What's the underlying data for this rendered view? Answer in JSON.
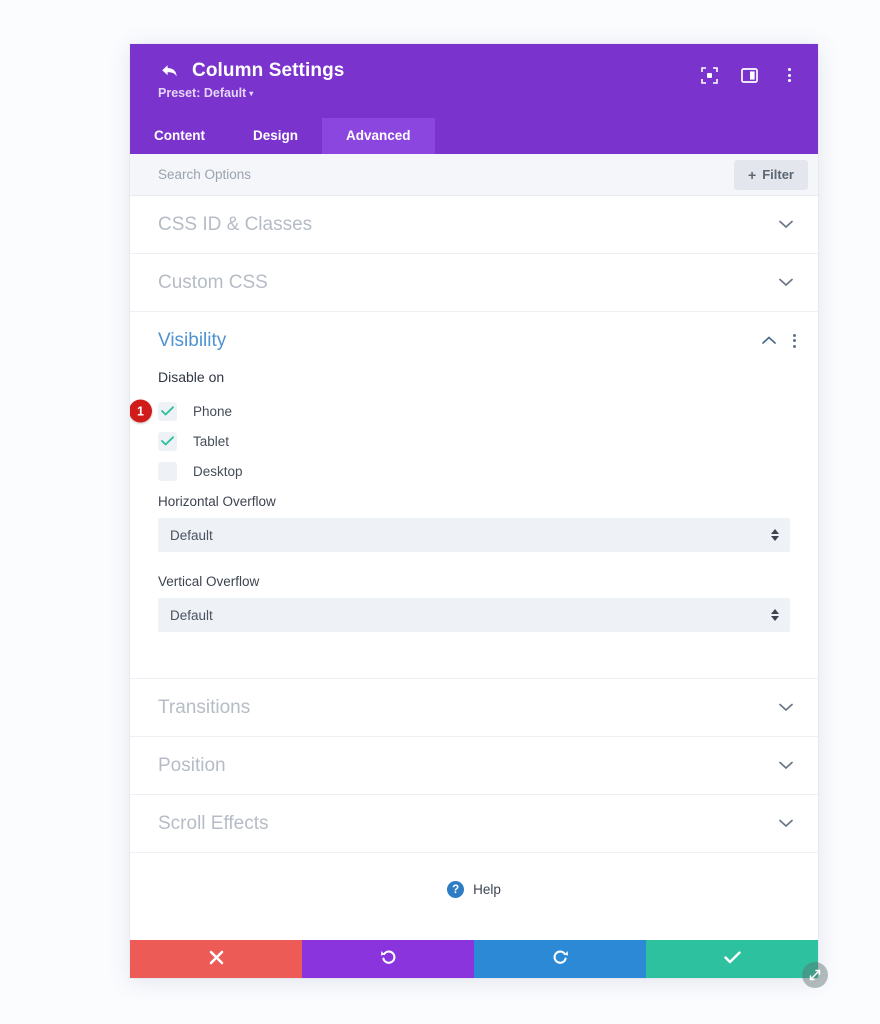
{
  "header": {
    "title": "Column Settings",
    "preset_label": "Preset: Default",
    "preset_caret": "▾",
    "back_icon": "back-arrow-icon",
    "icons": [
      {
        "name": "focus-frame-icon"
      },
      {
        "name": "split-layout-icon"
      },
      {
        "name": "more-options-icon"
      }
    ]
  },
  "tabs": [
    {
      "label": "Content",
      "active": false
    },
    {
      "label": "Design",
      "active": false
    },
    {
      "label": "Advanced",
      "active": true
    }
  ],
  "search": {
    "placeholder": "Search Options",
    "value": "",
    "filter_label": "Filter",
    "filter_plus": "+"
  },
  "sections": [
    {
      "title": "CSS ID & Classes",
      "open": false
    },
    {
      "title": "Custom CSS",
      "open": false
    },
    {
      "title": "Visibility",
      "open": true
    },
    {
      "title": "Transitions",
      "open": false
    },
    {
      "title": "Position",
      "open": false
    },
    {
      "title": "Scroll Effects",
      "open": false
    }
  ],
  "visibility": {
    "disable_on_label": "Disable on",
    "checkboxes": [
      {
        "label": "Phone",
        "checked": true,
        "badge": "1"
      },
      {
        "label": "Tablet",
        "checked": true,
        "badge": null
      },
      {
        "label": "Desktop",
        "checked": false,
        "badge": null
      }
    ],
    "horizontal_overflow": {
      "label": "Horizontal Overflow",
      "value": "Default"
    },
    "vertical_overflow": {
      "label": "Vertical Overflow",
      "value": "Default"
    }
  },
  "help": {
    "label": "Help",
    "icon_glyph": "?"
  },
  "footer": {
    "buttons": [
      {
        "name": "cancel-button",
        "icon": "close-x-icon",
        "color": "#ec5b56"
      },
      {
        "name": "undo-button",
        "icon": "undo-icon",
        "color": "#8a34de"
      },
      {
        "name": "redo-button",
        "icon": "redo-icon",
        "color": "#2b89d6"
      },
      {
        "name": "save-button",
        "icon": "checkmark-icon",
        "color": "#2ec1a0"
      }
    ],
    "resize_handle": "resize-handle-icon"
  },
  "colors": {
    "header_purple": "#7a33cc",
    "tab_active_purple": "#8c46e0",
    "section_open_blue": "#4f93d4",
    "check_teal": "#2ec1a0",
    "badge_red": "#d11b1b"
  }
}
